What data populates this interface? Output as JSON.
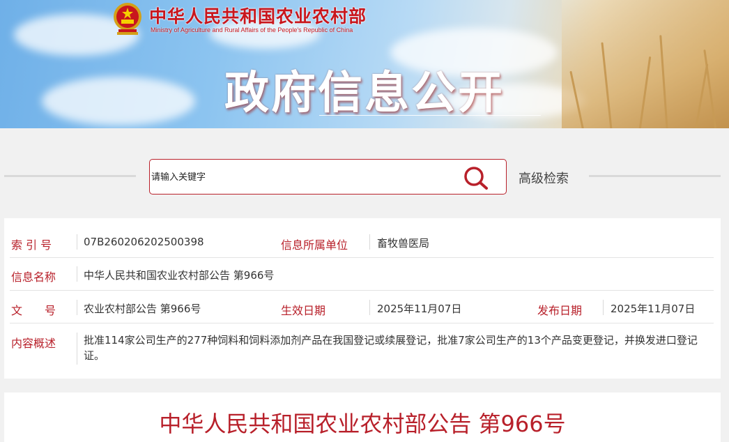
{
  "header": {
    "logo_cn": "中华人民共和国农业农村部",
    "logo_en": "Ministry of Agriculture and Rural Affairs of the People's Republic of China",
    "banner_title": "政府信息公开"
  },
  "search": {
    "placeholder": "请输入关键字",
    "advanced_label": "高级检索",
    "icon": "search-icon"
  },
  "info": {
    "index_label": "索 引 号",
    "index_value": "07B260206202500398",
    "unit_label": "信息所属单位",
    "unit_value": "畜牧兽医局",
    "name_label": "信息名称",
    "name_value": "中华人民共和国农业农村部公告 第966号",
    "doc_label": "文　　号",
    "doc_value": "农业农村部公告 第966号",
    "effective_label": "生效日期",
    "effective_value": "2025年11月07日",
    "publish_label": "发布日期",
    "publish_value": "2025年11月07日",
    "summary_label": "内容概述",
    "summary_value": "批准114家公司生产的277种饲料和饲料添加剂产品在我国登记或续展登记，批准7家公司生产的13个产品变更登记，并换发进口登记证。"
  },
  "article": {
    "title": "中华人民共和国农业农村部公告 第966号"
  },
  "colors": {
    "accent": "#b8202a",
    "background": "#f1f1f1"
  }
}
